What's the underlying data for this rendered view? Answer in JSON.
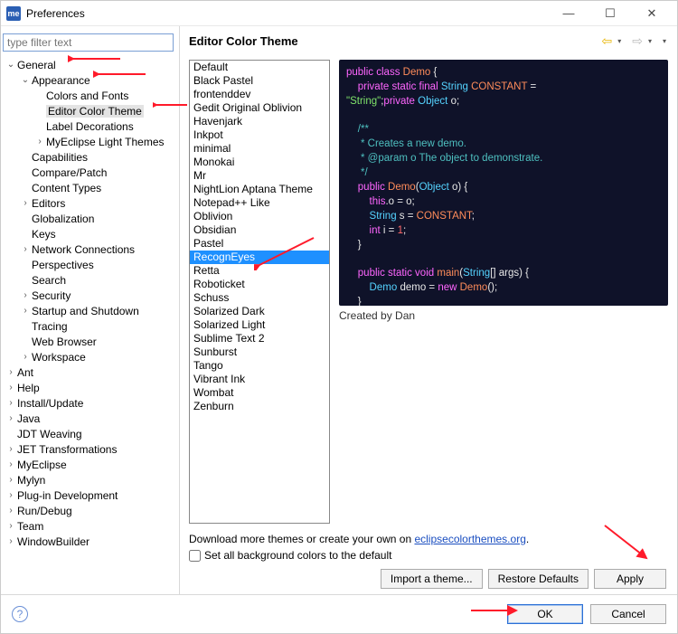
{
  "window": {
    "title": "Preferences"
  },
  "filter_placeholder": "type filter text",
  "page_title": "Editor Color Theme",
  "tree": [
    {
      "label": "General",
      "depth": 0,
      "exp": true
    },
    {
      "label": "Appearance",
      "depth": 1,
      "exp": true
    },
    {
      "label": "Colors and Fonts",
      "depth": 2,
      "exp": null
    },
    {
      "label": "Editor Color Theme",
      "depth": 2,
      "exp": null,
      "selected": true
    },
    {
      "label": "Label Decorations",
      "depth": 2,
      "exp": null
    },
    {
      "label": "MyEclipse Light Themes",
      "depth": 2,
      "exp": false
    },
    {
      "label": "Capabilities",
      "depth": 1,
      "exp": null
    },
    {
      "label": "Compare/Patch",
      "depth": 1,
      "exp": null
    },
    {
      "label": "Content Types",
      "depth": 1,
      "exp": null
    },
    {
      "label": "Editors",
      "depth": 1,
      "exp": false
    },
    {
      "label": "Globalization",
      "depth": 1,
      "exp": null
    },
    {
      "label": "Keys",
      "depth": 1,
      "exp": null
    },
    {
      "label": "Network Connections",
      "depth": 1,
      "exp": false
    },
    {
      "label": "Perspectives",
      "depth": 1,
      "exp": null
    },
    {
      "label": "Search",
      "depth": 1,
      "exp": null
    },
    {
      "label": "Security",
      "depth": 1,
      "exp": false
    },
    {
      "label": "Startup and Shutdown",
      "depth": 1,
      "exp": false
    },
    {
      "label": "Tracing",
      "depth": 1,
      "exp": null
    },
    {
      "label": "Web Browser",
      "depth": 1,
      "exp": null
    },
    {
      "label": "Workspace",
      "depth": 1,
      "exp": false
    },
    {
      "label": "Ant",
      "depth": 0,
      "exp": false
    },
    {
      "label": "Help",
      "depth": 0,
      "exp": false
    },
    {
      "label": "Install/Update",
      "depth": 0,
      "exp": false
    },
    {
      "label": "Java",
      "depth": 0,
      "exp": false
    },
    {
      "label": "JDT Weaving",
      "depth": 0,
      "exp": null
    },
    {
      "label": "JET Transformations",
      "depth": 0,
      "exp": false
    },
    {
      "label": "MyEclipse",
      "depth": 0,
      "exp": false
    },
    {
      "label": "Mylyn",
      "depth": 0,
      "exp": false
    },
    {
      "label": "Plug-in Development",
      "depth": 0,
      "exp": false
    },
    {
      "label": "Run/Debug",
      "depth": 0,
      "exp": false
    },
    {
      "label": "Team",
      "depth": 0,
      "exp": false
    },
    {
      "label": "WindowBuilder",
      "depth": 0,
      "exp": false
    }
  ],
  "themes": [
    "Default",
    "Black Pastel",
    "frontenddev",
    "Gedit Original Oblivion",
    "Havenjark",
    "Inkpot",
    "minimal",
    "Monokai",
    "Mr",
    "NightLion Aptana Theme",
    "Notepad++ Like",
    "Oblivion",
    "Obsidian",
    "Pastel",
    "RecognEyes",
    "Retta",
    "Roboticket",
    "Schuss",
    "Solarized Dark",
    "Solarized Light",
    "Sublime Text 2",
    "Sunburst",
    "Tango",
    "Vibrant Ink",
    "Wombat",
    "Zenburn"
  ],
  "selected_theme": "RecognEyes",
  "created_by": "Created by Dan",
  "download_text": "Download more themes or create your own on ",
  "download_link": "eclipsecolorthemes.org",
  "checkbox_label": "Set all background colors to the default",
  "buttons": {
    "import": "Import a theme...",
    "restore": "Restore Defaults",
    "apply": "Apply",
    "ok": "OK",
    "cancel": "Cancel"
  },
  "code": {
    "l1a": "public class ",
    "l1b": "Demo",
    "l1c": " {",
    "l2a": "    private static final ",
    "l2b": "String",
    "l2c": " CONSTANT",
    "l2d": " =",
    "l3a": "\"String\"",
    "l3b": ";",
    "l3c": "private ",
    "l3d": "Object",
    "l3e": " o",
    "l3f": ";",
    "l5a": "    /**",
    "l6a": "     * Creates a new demo.",
    "l7a": "     * @param o The object to demonstrate.",
    "l8a": "     */",
    "l9a": "    public ",
    "l9b": "Demo",
    "l9c": "(",
    "l9d": "Object",
    "l9e": " o",
    "l9f": ") {",
    "l10a": "        this",
    "l10b": ".o = o;",
    "l11a": "        String",
    "l11b": " s = ",
    "l11c": "CONSTANT",
    "l11d": ";",
    "l12a": "        int",
    "l12b": " i = ",
    "l12c": "1",
    "l12d": ";",
    "l13a": "    }",
    "l15a": "    public static void ",
    "l15b": "main",
    "l15c": "(",
    "l15d": "String",
    "l15e": "[] args",
    "l15f": ") {",
    "l16a": "        Demo",
    "l16b": " demo = ",
    "l16c": "new ",
    "l16d": "Demo",
    "l16e": "();",
    "l17a": "    }",
    "l18a": "}"
  }
}
